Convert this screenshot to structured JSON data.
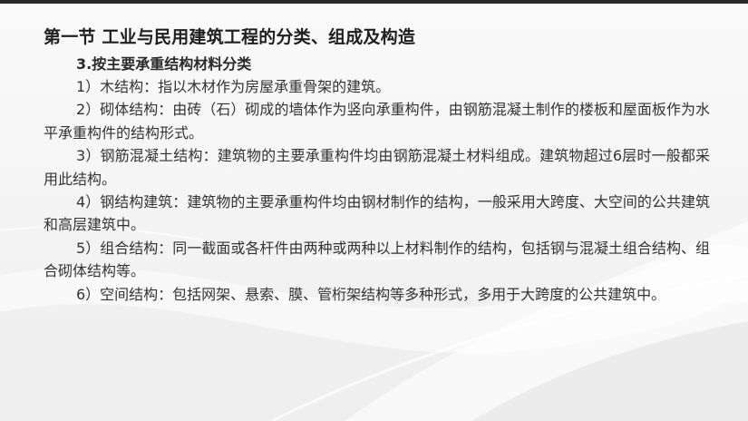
{
  "slide": {
    "section_title": "第一节 工业与民用建筑工程的分类、组成及构造",
    "sub_heading": "3.按主要承重结构材料分类",
    "paragraphs": [
      "1）木结构：指以木材作为房屋承重骨架的建筑。",
      "2）砌体结构：由砖（石）砌成的墙体作为竖向承重构件，由钢筋混凝土制作的楼板和屋面板作为水平承重构件的结构形式。",
      "3）钢筋混凝土结构：建筑物的主要承重构件均由钢筋混凝土材料组成。建筑物超过6层时一般都采用此结构。",
      "4）钢结构建筑：建筑物的主要承重构件均由钢材制作的结构，一般采用大跨度、大空间的公共建筑和高层建筑中。",
      "5）组合结构：同一截面或各杆件由两种或两种以上材料制作的结构，包括钢与混凝土组合结构、组合砌体结构等。",
      "6）空间结构：包括网架、悬索、膜、管桁架结构等多种形式，多用于大跨度的公共建筑中。"
    ]
  },
  "colors": {
    "top_bar": "#2a2a2a",
    "background": "#f7f7f7",
    "text": "#333333"
  }
}
